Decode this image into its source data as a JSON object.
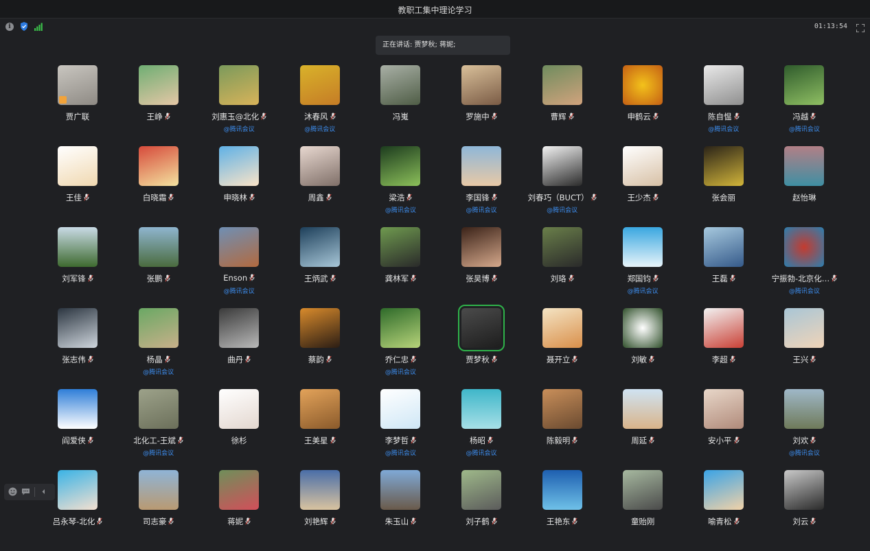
{
  "window": {
    "title": "教职工集中理论学习"
  },
  "status": {
    "timer": "01:13:54"
  },
  "speaking": {
    "text": "正在讲话: 贾梦秋; 蒋妮;"
  },
  "colors": {
    "background": "#1f2023",
    "accent": "#3d8ef0",
    "active_speaker": "#2fb34a"
  },
  "icons": [
    "info-icon",
    "shield-icon",
    "signal-icon",
    "fullscreen-icon",
    "mic-icon",
    "emoji-icon",
    "chat-icon",
    "collapse-icon"
  ],
  "participants": [
    {
      "name": "贾广联",
      "sub": "",
      "mic": false,
      "bg": "linear-gradient(160deg,#c9c6c0,#8e8a84)"
    },
    {
      "name": "王峥",
      "sub": "",
      "mic": true,
      "bg": "linear-gradient(160deg,#6fae73,#e5c7a6)"
    },
    {
      "name": "刘惠玉@北化",
      "sub": "@腾讯会议",
      "mic": true,
      "bg": "linear-gradient(160deg,#7b9a5b,#d8b35a)"
    },
    {
      "name": "沐春风",
      "sub": "@腾讯会议",
      "mic": true,
      "bg": "linear-gradient(160deg,#d9b22a,#c57c26)"
    },
    {
      "name": "冯嵬",
      "sub": "",
      "mic": false,
      "bg": "linear-gradient(160deg,#a9b0a6,#4f5d46)"
    },
    {
      "name": "罗施中",
      "sub": "",
      "mic": true,
      "bg": "linear-gradient(160deg,#d9c09a,#7a5b45)"
    },
    {
      "name": "曹辉",
      "sub": "",
      "mic": true,
      "bg": "linear-gradient(160deg,#6f8c5e,#d1a37d)"
    },
    {
      "name": "申鹤云",
      "sub": "",
      "mic": true,
      "bg": "radial-gradient(circle,#f3c21b,#c45f14)"
    },
    {
      "name": "陈自愠",
      "sub": "@腾讯会议",
      "mic": true,
      "bg": "linear-gradient(160deg,#e9e9e9,#8f8f8f)"
    },
    {
      "name": "冯越",
      "sub": "@腾讯会议",
      "mic": true,
      "bg": "linear-gradient(160deg,#2f5b2c,#8fbf63)"
    },
    {
      "name": "王佳",
      "sub": "",
      "mic": true,
      "bg": "linear-gradient(160deg,#ffffff,#f0d8b0)"
    },
    {
      "name": "白晓霜",
      "sub": "",
      "mic": true,
      "bg": "linear-gradient(160deg,#d64a3b,#f4e3a0)"
    },
    {
      "name": "申晓林",
      "sub": "",
      "mic": true,
      "bg": "linear-gradient(160deg,#5fb1e6,#fbe4c8)"
    },
    {
      "name": "周鑫",
      "sub": "",
      "mic": true,
      "bg": "linear-gradient(160deg,#e8d8d0,#7f6f68)"
    },
    {
      "name": "梁浩",
      "sub": "@腾讯会议",
      "mic": true,
      "bg": "linear-gradient(160deg,#1c3b1e,#8cc05a)"
    },
    {
      "name": "李国锋",
      "sub": "@腾讯会议",
      "mic": true,
      "bg": "linear-gradient(180deg,#8fb7d8,#e8c9a6)"
    },
    {
      "name": "刘春巧（BUCT）",
      "sub": "@腾讯会议",
      "mic": true,
      "bg": "linear-gradient(160deg,#f2f2f2,#2b2b2b)"
    },
    {
      "name": "王少杰",
      "sub": "",
      "mic": true,
      "bg": "linear-gradient(160deg,#ffffff,#d7c0a5)"
    },
    {
      "name": "张会丽",
      "sub": "",
      "mic": false,
      "bg": "linear-gradient(160deg,#2a2318,#d2b53a)"
    },
    {
      "name": "赵怡琳",
      "sub": "",
      "mic": false,
      "bg": "linear-gradient(180deg,#b27f86,#3f8fa3)"
    },
    {
      "name": "刘军锋",
      "sub": "",
      "mic": true,
      "bg": "linear-gradient(180deg,#c9dbe6,#3e6a2f)"
    },
    {
      "name": "张鹏",
      "sub": "",
      "mic": true,
      "bg": "linear-gradient(180deg,#8fb5cf,#4a6b3e)"
    },
    {
      "name": "Enson",
      "sub": "@腾讯会议",
      "mic": true,
      "bg": "linear-gradient(160deg,#6f8fb4,#b26a3f)"
    },
    {
      "name": "王炳武",
      "sub": "",
      "mic": true,
      "bg": "linear-gradient(160deg,#1d3f5a,#a8c7d8)"
    },
    {
      "name": "龚林军",
      "sub": "",
      "mic": true,
      "bg": "linear-gradient(160deg,#6f9a4f,#2a2a2a)"
    },
    {
      "name": "张昊博",
      "sub": "",
      "mic": true,
      "bg": "linear-gradient(160deg,#3a2218,#d6a98c)"
    },
    {
      "name": "刘珞",
      "sub": "",
      "mic": true,
      "bg": "linear-gradient(160deg,#6a7f4a,#2a2a2a)"
    },
    {
      "name": "郑国钧",
      "sub": "@腾讯会议",
      "mic": true,
      "bg": "linear-gradient(180deg,#3aa7e0,#e8f4fa)"
    },
    {
      "name": "王磊",
      "sub": "",
      "mic": true,
      "bg": "linear-gradient(160deg,#a7c9de,#355a8a)"
    },
    {
      "name": "宁振勃-北京化…",
      "sub": "@腾讯会议",
      "mic": true,
      "bg": "radial-gradient(circle,#c43b2f,#2b7fb0)"
    },
    {
      "name": "张志伟",
      "sub": "",
      "mic": true,
      "bg": "linear-gradient(160deg,#2b3540,#cfd6dd)"
    },
    {
      "name": "杨晶",
      "sub": "@腾讯会议",
      "mic": true,
      "bg": "linear-gradient(160deg,#6aa864,#c8b08a)"
    },
    {
      "name": "曲丹",
      "sub": "",
      "mic": true,
      "bg": "linear-gradient(160deg,#3a3a3a,#b9b9b9)"
    },
    {
      "name": "蔡韵",
      "sub": "",
      "mic": true,
      "bg": "linear-gradient(160deg,#d98b2c,#2b1d14)"
    },
    {
      "name": "乔仁忠",
      "sub": "@腾讯会议",
      "mic": true,
      "bg": "linear-gradient(160deg,#2e6a2a,#b7d47a)"
    },
    {
      "name": "贾梦秋",
      "sub": "",
      "mic": true,
      "active": true,
      "bg": "linear-gradient(160deg,#4b4b4b,#1d1d1d)"
    },
    {
      "name": "聂开立",
      "sub": "",
      "mic": true,
      "bg": "linear-gradient(160deg,#f4e4c4,#d98f4a)"
    },
    {
      "name": "刘敏",
      "sub": "",
      "mic": true,
      "bg": "radial-gradient(circle,#ffffff,#2f4f2a)"
    },
    {
      "name": "李超",
      "sub": "",
      "mic": true,
      "bg": "linear-gradient(160deg,#f2f2f2,#c94035)"
    },
    {
      "name": "王兴",
      "sub": "",
      "mic": true,
      "bg": "linear-gradient(160deg,#a9c6d6,#f0d4b8)"
    },
    {
      "name": "阎爱侠",
      "sub": "",
      "mic": true,
      "bg": "linear-gradient(180deg,#2f7ed8,#ffffff)"
    },
    {
      "name": "北化工-王斌",
      "sub": "@腾讯会议",
      "mic": true,
      "bg": "linear-gradient(160deg,#9da28a,#6b6f5a)"
    },
    {
      "name": "徐杉",
      "sub": "",
      "mic": false,
      "bg": "linear-gradient(160deg,#ffffff,#e3d7cf)"
    },
    {
      "name": "王美星",
      "sub": "",
      "mic": true,
      "bg": "linear-gradient(160deg,#e3a35a,#8a5a2b)"
    },
    {
      "name": "李梦哲",
      "sub": "@腾讯会议",
      "mic": true,
      "bg": "linear-gradient(160deg,#ffffff,#cfe7f6)"
    },
    {
      "name": "杨昭",
      "sub": "@腾讯会议",
      "mic": true,
      "bg": "linear-gradient(180deg,#3fb6c9,#a7e0e7)"
    },
    {
      "name": "陈毅明",
      "sub": "",
      "mic": true,
      "bg": "linear-gradient(160deg,#c98f5a,#6a4a30)"
    },
    {
      "name": "周延",
      "sub": "",
      "mic": true,
      "bg": "linear-gradient(180deg,#cfe3f2,#d9b48a)"
    },
    {
      "name": "安小平",
      "sub": "",
      "mic": true,
      "bg": "linear-gradient(160deg,#e8d7c9,#b08a7a)"
    },
    {
      "name": "刘欢",
      "sub": "@腾讯会议",
      "mic": true,
      "bg": "linear-gradient(180deg,#9fb8c8,#6f7a5a)"
    },
    {
      "name": "吕永琴-北化",
      "sub": "",
      "mic": true,
      "bg": "linear-gradient(160deg,#3ab3e6,#f4e0d0)"
    },
    {
      "name": "司志豪",
      "sub": "",
      "mic": true,
      "bg": "linear-gradient(180deg,#8fb4d6,#b99a72)"
    },
    {
      "name": "蒋妮",
      "sub": "",
      "mic": true,
      "bg": "linear-gradient(160deg,#6f8f5a,#d24f5a)"
    },
    {
      "name": "刘艳辉",
      "sub": "",
      "mic": true,
      "bg": "linear-gradient(180deg,#4a6ea8,#d9c3a0)"
    },
    {
      "name": "朱玉山",
      "sub": "",
      "mic": true,
      "bg": "linear-gradient(180deg,#7fa9d6,#6a5a4a)"
    },
    {
      "name": "刘子鹤",
      "sub": "",
      "mic": true,
      "bg": "linear-gradient(160deg,#9fb98a,#5b5b5b)"
    },
    {
      "name": "王艳东",
      "sub": "",
      "mic": true,
      "bg": "linear-gradient(180deg,#1e5fb0,#6fc1e8)"
    },
    {
      "name": "童贻刚",
      "sub": "",
      "mic": false,
      "bg": "linear-gradient(160deg,#a7b9a0,#4a4a4a)"
    },
    {
      "name": "喻青松",
      "sub": "",
      "mic": true,
      "bg": "linear-gradient(160deg,#3aa3e6,#f2d2a8)"
    },
    {
      "name": "刘云",
      "sub": "",
      "mic": true,
      "bg": "linear-gradient(160deg,#c9c9c9,#2a2a2a)"
    }
  ]
}
